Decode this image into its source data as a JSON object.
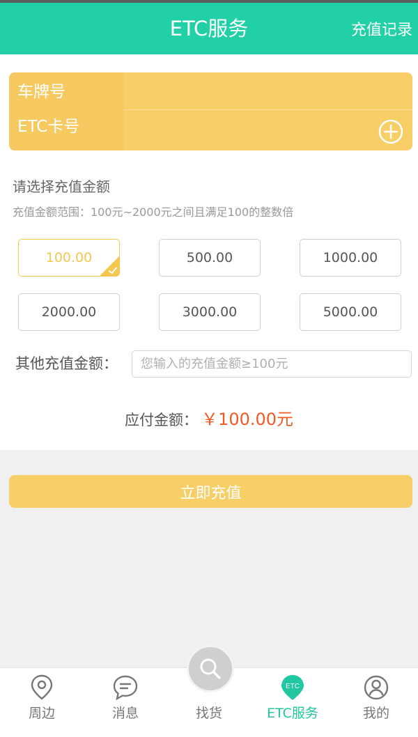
{
  "header": {
    "title": "ETC服务",
    "action": "充值记录"
  },
  "card": {
    "plate_label": "车牌号",
    "etc_label": "ETC卡号"
  },
  "amount": {
    "title": "请选择充值金额",
    "hint": "充值金额范围：100元~2000元之间且满足100的整数倍",
    "options": [
      "100.00",
      "500.00",
      "1000.00",
      "2000.00",
      "3000.00",
      "5000.00"
    ],
    "selected_index": 0,
    "other_label": "其他充值金额：",
    "other_placeholder": "您输入的充值金额≥100元",
    "other_value": ""
  },
  "payment": {
    "label": "应付金额：",
    "value": "￥100.00元"
  },
  "submit_label": "立即充值",
  "colors": {
    "brand": "#21d0a7",
    "accent": "#f8cf67",
    "price": "#f15a24"
  },
  "nav": {
    "items": [
      {
        "label": "周边",
        "icon": "location-pin-icon"
      },
      {
        "label": "消息",
        "icon": "chat-bubble-icon"
      },
      {
        "label": "找货",
        "icon": "search-icon"
      },
      {
        "label": "ETC服务",
        "icon": "etc-icon",
        "icon_text": "ETC"
      },
      {
        "label": "我的",
        "icon": "user-profile-icon"
      }
    ],
    "active_index": 3
  }
}
